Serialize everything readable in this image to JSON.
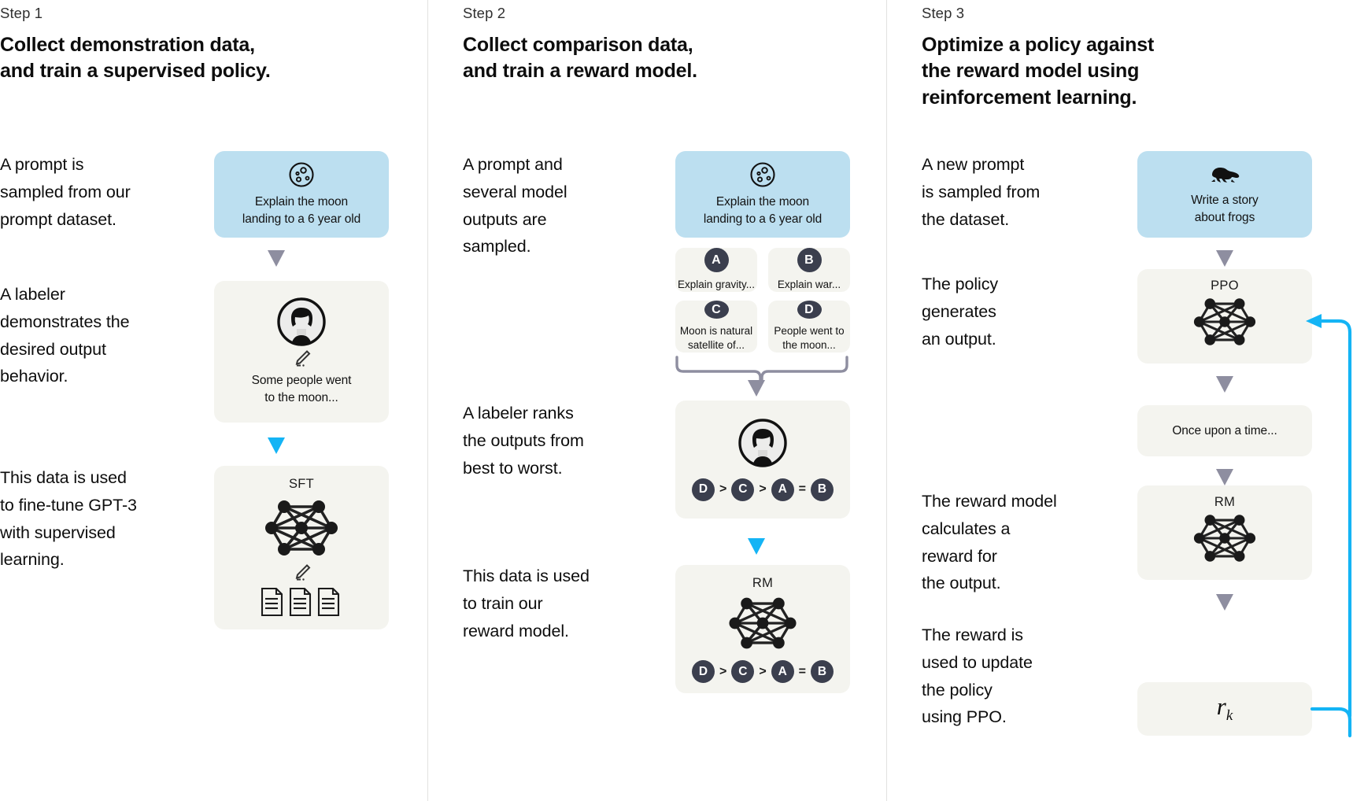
{
  "meta": {
    "colors": {
      "prompt_card": "#bcdff0",
      "neutral_card": "#f4f4ef",
      "gray_arrow": "#8e8ea0",
      "blue_arrow": "#14b4f5",
      "badge": "#3b3f4e",
      "divider": "#e2e2e0"
    }
  },
  "columns": [
    {
      "step_label": "Step 1",
      "step_title": "Collect demonstration data,\nand train a supervised policy.",
      "paragraphs": [
        "A prompt is\nsampled from our\nprompt dataset.",
        "A labeler\ndemonstrates the\ndesired output\nbehavior.",
        "This data is used\nto fine-tune GPT-3\nwith supervised\nlearning."
      ],
      "cards": {
        "prompt": {
          "icon": "moon-icon",
          "text": "Explain the moon\nlanding to a 6 year old"
        },
        "labeler": {
          "icon": "labeler-avatar-icon",
          "text": "Some people went\nto the moon..."
        },
        "sft": {
          "title": "SFT",
          "icon": "neural-network-icon"
        }
      }
    },
    {
      "step_label": "Step 2",
      "step_title": "Collect comparison data,\nand train a reward model.",
      "paragraphs": [
        "A prompt and\nseveral model\noutputs are\nsampled.",
        "A labeler ranks\nthe outputs from\nbest to worst.",
        "This data is used\nto train our\nreward model."
      ],
      "cards": {
        "prompt": {
          "icon": "moon-icon",
          "text": "Explain the moon\nlanding to a 6 year old"
        },
        "outputs": [
          {
            "badge": "A",
            "text": "Explain gravity..."
          },
          {
            "badge": "B",
            "text": "Explain war..."
          },
          {
            "badge": "C",
            "text": "Moon is natural\nsatellite of..."
          },
          {
            "badge": "D",
            "text": "People went to\nthe moon..."
          }
        ],
        "ranking": {
          "icon": "labeler-avatar-icon",
          "order": [
            "D",
            ">",
            "C",
            ">",
            "A",
            "=",
            "B"
          ]
        },
        "rm": {
          "title": "RM",
          "icon": "neural-network-icon",
          "order": [
            "D",
            ">",
            "C",
            ">",
            "A",
            "=",
            "B"
          ]
        }
      }
    },
    {
      "step_label": "Step 3",
      "step_title": "Optimize a policy against\nthe reward model using\nreinforcement learning.",
      "paragraphs": [
        "A new prompt\nis sampled from\nthe dataset.",
        "The policy\ngenerates\nan output.",
        "The reward model\ncalculates a\nreward for\nthe output.",
        "The reward is\nused to update\nthe policy\nusing PPO."
      ],
      "cards": {
        "prompt": {
          "icon": "frog-icon",
          "text": "Write a story\nabout frogs"
        },
        "ppo": {
          "title": "PPO",
          "icon": "neural-network-icon"
        },
        "output": {
          "text": "Once upon a time..."
        },
        "rm": {
          "title": "RM",
          "icon": "neural-network-icon"
        },
        "reward": {
          "symbol": "r",
          "subscript": "k"
        }
      }
    }
  ]
}
